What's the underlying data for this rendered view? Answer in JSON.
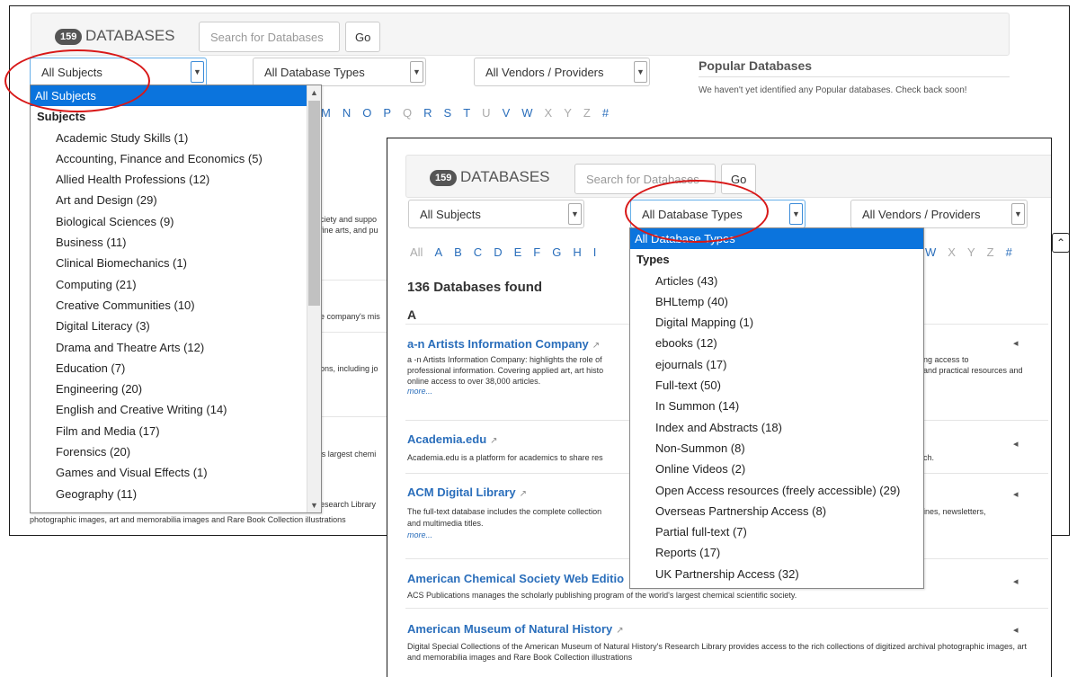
{
  "background_window": {
    "badge": "159",
    "title": "DATABASES",
    "search_placeholder": "Search for Databases",
    "go_label": "Go",
    "subjects_select": "All Subjects",
    "types_select": "All Database Types",
    "vendors_select": "All Vendors / Providers",
    "popular_title": "Popular Databases",
    "popular_text": "We haven't yet identified any Popular databases. Check back soon!",
    "az_letters": [
      "M",
      "N",
      "O",
      "P",
      "Q",
      "R",
      "S",
      "T",
      "U",
      "V",
      "W",
      "X",
      "Y",
      "Z",
      "#"
    ],
    "text_fragments": [
      "ciety and suppo",
      "fine arts, and pu",
      "e company's mis",
      "ons, including jo",
      "'s largest chemi",
      "esearch Library",
      "photographic images, art and memorabilia images and Rare Book Collection illustrations"
    ],
    "back_to_top_icon": "double-chevron-up-icon"
  },
  "subjects_dropdown": {
    "selected": "All Subjects",
    "group_label": "Subjects",
    "items": [
      "Academic Study Skills (1)",
      "Accounting, Finance and Economics (5)",
      "Allied Health Professions (12)",
      "Art and Design (29)",
      "Biological Sciences (9)",
      "Business (11)",
      "Clinical Biomechanics (1)",
      "Computing (21)",
      "Creative Communities (10)",
      "Digital Literacy (3)",
      "Drama and Theatre Arts (12)",
      "Education (7)",
      "Engineering (20)",
      "English and Creative Writing (14)",
      "Film and Media (17)",
      "Forensics (20)",
      "Games and Visual Effects (1)",
      "Geography (11)"
    ]
  },
  "foreground_window": {
    "badge": "159",
    "title": "DATABASES",
    "search_placeholder": "Search for Databases",
    "go_label": "Go",
    "subjects_select": "All Subjects",
    "types_select": "All Database Types",
    "vendors_select": "All Vendors / Providers",
    "az_left": [
      "All",
      "A",
      "B",
      "C",
      "D",
      "E",
      "F",
      "G",
      "H",
      "I"
    ],
    "az_right": [
      "W",
      "X",
      "Y",
      "Z",
      "#"
    ],
    "found_text": "136 Databases found",
    "section_letter": "A",
    "entries": [
      {
        "title": "a-n Artists Information Company",
        "desc_left": "a -n Artists Information Company: highlights the role of",
        "desc_left_2": "professional information. Covering applied art, art histo",
        "desc_line3": "online access to over 38,000 articles.",
        "desc_right": "ng access to",
        "desc_right_2": "and practical resources and",
        "more": "more..."
      },
      {
        "title": "Academia.edu",
        "desc_left": "Academia.edu is a platform for academics to share res",
        "desc_right": "ch."
      },
      {
        "title": "ACM Digital Library",
        "desc_left": "The full-text database includes the complete collection",
        "desc_right": "ines, newsletters,",
        "desc_line2": "and multimedia titles.",
        "more": "more..."
      },
      {
        "title": "American Chemical Society Web Editio",
        "desc": "ACS Publications manages the scholarly publishing program of the world's largest chemical scientific society."
      },
      {
        "title": "American Museum of Natural History",
        "desc": "Digital Special Collections of the American Museum of Natural History's Research Library provides access to the rich collections of digitized archival photographic images, art and memorabilia images and Rare Book Collection illustrations"
      }
    ]
  },
  "types_dropdown": {
    "selected": "All Database Types",
    "group_label": "Types",
    "items": [
      "Articles (43)",
      "BHLtemp (40)",
      "Digital Mapping (1)",
      "ebooks (12)",
      "ejournals (17)",
      "Full-text (50)",
      "In Summon (14)",
      "Index and Abstracts (18)",
      "Non-Summon (8)",
      "Online Videos (2)",
      "Open Access resources (freely accessible) (29)",
      "Overseas Partnership Access (8)",
      "Partial full-text (7)",
      "Reports (17)",
      "UK Partnership Access (32)"
    ]
  },
  "colors": {
    "link": "#2a6ebb",
    "highlight": "#0b74dd",
    "annotation": "#d81818"
  }
}
